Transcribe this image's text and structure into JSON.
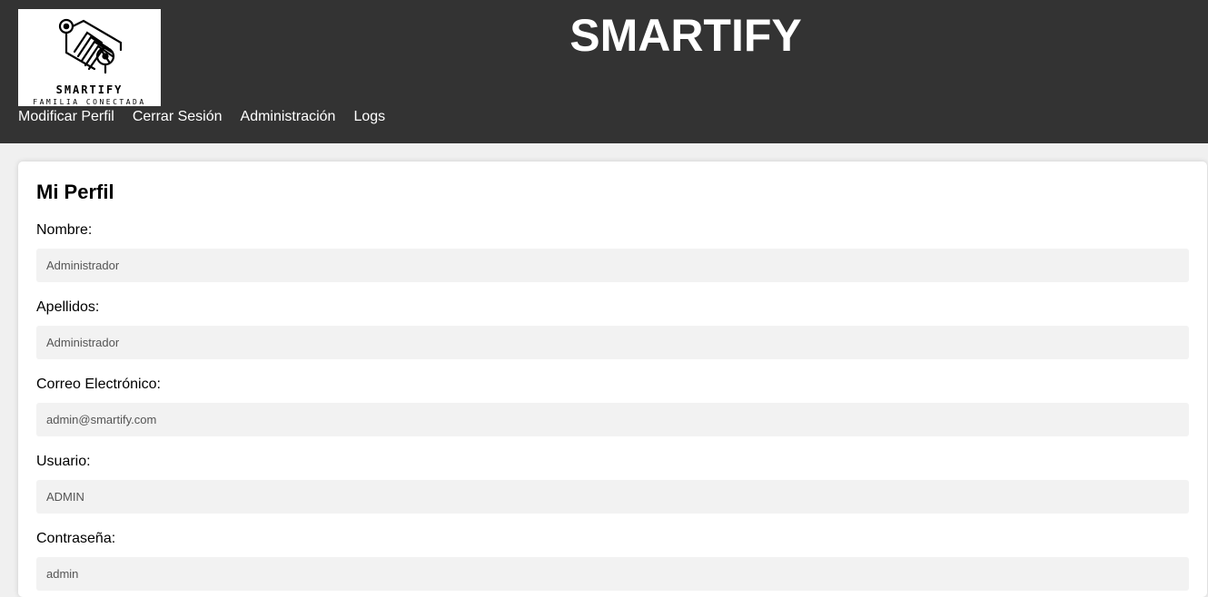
{
  "header": {
    "logo": {
      "icon": "house-circuit-icon",
      "name": "SMARTIFY",
      "tagline": "FAMILIA CONECTADA"
    },
    "title": "SMARTIFY",
    "nav": [
      {
        "label": "Modificar Perfil"
      },
      {
        "label": "Cerrar Sesión"
      },
      {
        "label": "Administración"
      },
      {
        "label": "Logs"
      }
    ]
  },
  "profile": {
    "title": "Mi Perfil",
    "fields": [
      {
        "label": "Nombre:",
        "value": "Administrador"
      },
      {
        "label": "Apellidos:",
        "value": "Administrador"
      },
      {
        "label": "Correo Electrónico:",
        "value": "admin@smartify.com"
      },
      {
        "label": "Usuario:",
        "value": "ADMIN"
      },
      {
        "label": "Contraseña:",
        "value": "admin"
      }
    ]
  },
  "colors": {
    "header_bg": "#333333",
    "page_bg": "#f0f0f0",
    "input_bg": "#f2f2f2"
  }
}
